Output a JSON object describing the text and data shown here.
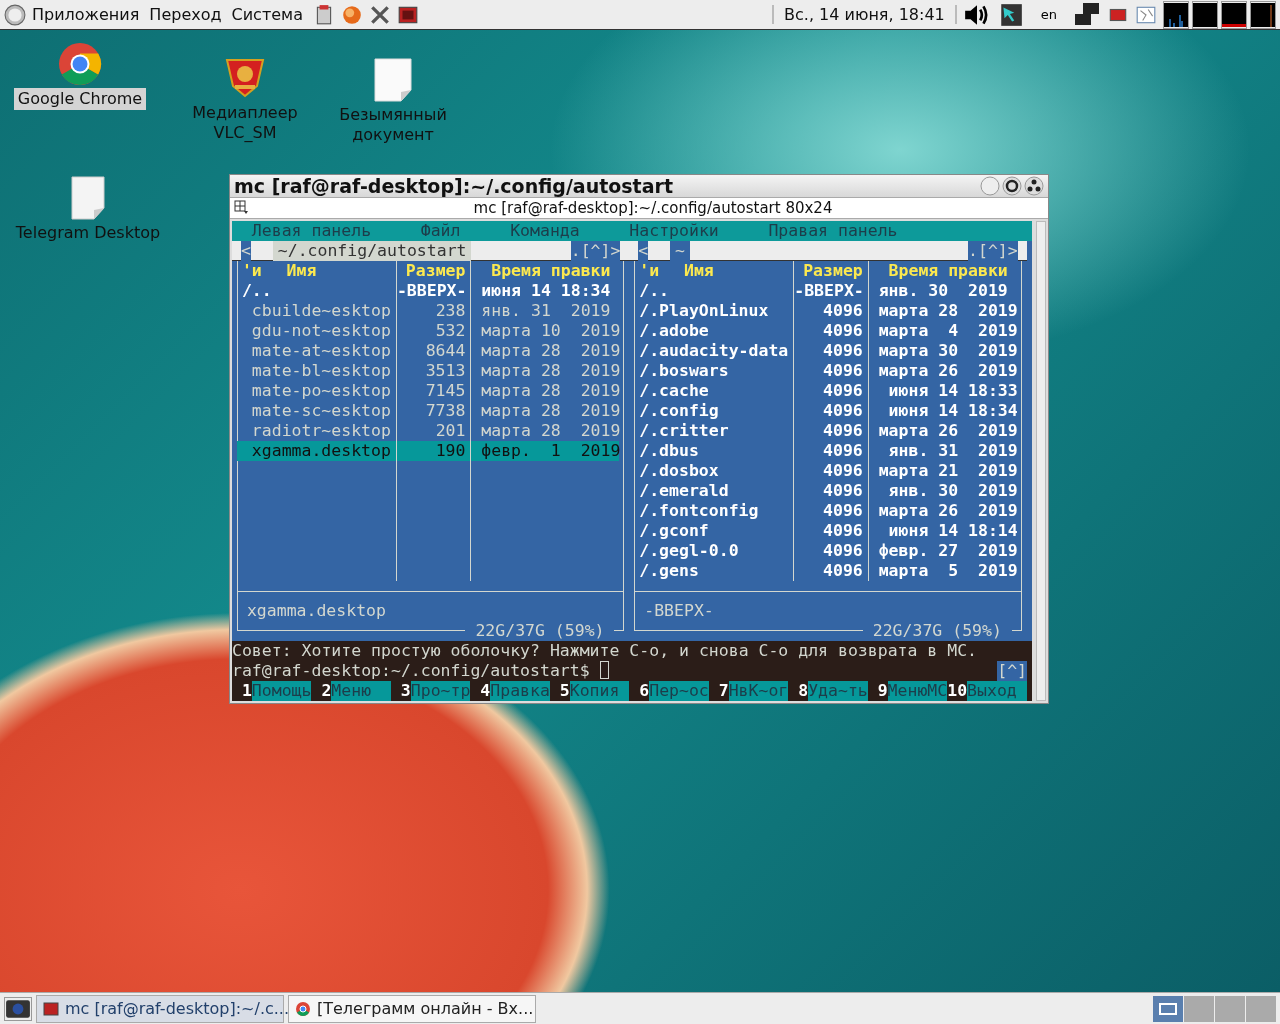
{
  "top_panel": {
    "menus": [
      "Приложения",
      "Переход",
      "Система"
    ],
    "clock": "Вс., 14 июня, 18:41",
    "layout": "en"
  },
  "desktop_icons": [
    {
      "label": "Google Chrome",
      "kind": "chrome",
      "selected": true
    },
    {
      "label": "Медиаплеер VLC_SM",
      "kind": "badge",
      "selected": false
    },
    {
      "label": "Безымянный документ",
      "kind": "document",
      "selected": false
    },
    {
      "label": "Telegram Desktop",
      "kind": "file",
      "selected": false
    }
  ],
  "terminal": {
    "title": "mc [raf@raf-desktop]:~/.config/autostart",
    "subtitle": "mc [raf@raf-desktop]:~/.config/autostart 80x24",
    "menu": [
      "Левая панель",
      "Файл",
      "Команда",
      "Настройки",
      "Правая панель"
    ],
    "panels": [
      {
        "path": "~/.config/autostart",
        "active": true,
        "nav_left": "<",
        "nav_right": ".[^]>",
        "sort_mark": "'и",
        "columns": [
          "Имя",
          "Размер",
          "Время правки"
        ],
        "rows": [
          {
            "name": "/..",
            "size": "-ВВЕРХ-",
            "date": "июня 14 18:34",
            "kind": "dir",
            "selected": false
          },
          {
            "name": "cbuilde~esktop",
            "size": "238",
            "date": "янв. 31  2019",
            "kind": "file",
            "selected": false
          },
          {
            "name": "gdu-not~esktop",
            "size": "532",
            "date": "марта 10  2019",
            "kind": "file",
            "selected": false
          },
          {
            "name": "mate-at~esktop",
            "size": "8644",
            "date": "марта 28  2019",
            "kind": "file",
            "selected": false
          },
          {
            "name": "mate-bl~esktop",
            "size": "3513",
            "date": "марта 28  2019",
            "kind": "file",
            "selected": false
          },
          {
            "name": "mate-po~esktop",
            "size": "7145",
            "date": "марта 28  2019",
            "kind": "file",
            "selected": false
          },
          {
            "name": "mate-sc~esktop",
            "size": "7738",
            "date": "марта 28  2019",
            "kind": "file",
            "selected": false
          },
          {
            "name": "radiotr~esktop",
            "size": "201",
            "date": "марта 28  2019",
            "kind": "file",
            "selected": false
          },
          {
            "name": "xgamma.desktop",
            "size": "190",
            "date": "февр.  1  2019",
            "kind": "file",
            "selected": true
          }
        ],
        "mini_status": "xgamma.desktop",
        "free": "22G/37G (59%)"
      },
      {
        "path": "~",
        "active": false,
        "nav_left": "<",
        "nav_right": ".[^]>",
        "sort_mark": "'и",
        "columns": [
          "Имя",
          "Размер",
          "Время правки"
        ],
        "rows": [
          {
            "name": "/..",
            "size": "-ВВЕРХ-",
            "date": "янв. 30  2019",
            "kind": "dir",
            "selected": false
          },
          {
            "name": "/.PlayOnLinux",
            "size": "4096",
            "date": "марта 28  2019",
            "kind": "dir",
            "selected": false
          },
          {
            "name": "/.adobe",
            "size": "4096",
            "date": "марта  4  2019",
            "kind": "dir",
            "selected": false
          },
          {
            "name": "/.audacity-data",
            "size": "4096",
            "date": "марта 30  2019",
            "kind": "dir",
            "selected": false
          },
          {
            "name": "/.boswars",
            "size": "4096",
            "date": "марта 26  2019",
            "kind": "dir",
            "selected": false
          },
          {
            "name": "/.cache",
            "size": "4096",
            "date": " июня 14 18:33",
            "kind": "dir",
            "selected": false
          },
          {
            "name": "/.config",
            "size": "4096",
            "date": " июня 14 18:34",
            "kind": "dir",
            "selected": false
          },
          {
            "name": "/.critter",
            "size": "4096",
            "date": "марта 26  2019",
            "kind": "dir",
            "selected": false
          },
          {
            "name": "/.dbus",
            "size": "4096",
            "date": " янв. 31  2019",
            "kind": "dir",
            "selected": false
          },
          {
            "name": "/.dosbox",
            "size": "4096",
            "date": "марта 21  2019",
            "kind": "dir",
            "selected": false
          },
          {
            "name": "/.emerald",
            "size": "4096",
            "date": " янв. 30  2019",
            "kind": "dir",
            "selected": false
          },
          {
            "name": "/.fontconfig",
            "size": "4096",
            "date": "марта 26  2019",
            "kind": "dir",
            "selected": false
          },
          {
            "name": "/.gconf",
            "size": "4096",
            "date": " июня 14 18:14",
            "kind": "dir",
            "selected": false
          },
          {
            "name": "/.gegl-0.0",
            "size": "4096",
            "date": "февр. 27  2019",
            "kind": "dir",
            "selected": false
          },
          {
            "name": "/.gens",
            "size": "4096",
            "date": "марта  5  2019",
            "kind": "dir",
            "selected": false
          }
        ],
        "mini_status": "-ВВЕРХ-",
        "free": "22G/37G (59%)"
      }
    ],
    "hint": "Совет: Хотите простую оболочку? Нажмите C-o, и снова C-o для возврата в MC.",
    "prompt": "raf@raf-desktop:~/.config/autostart$",
    "prompt_marker": "[^]",
    "fkeys": [
      {
        "num": "1",
        "label": "Помощь"
      },
      {
        "num": "2",
        "label": "Меню"
      },
      {
        "num": "3",
        "label": "Про~тр"
      },
      {
        "num": "4",
        "label": "Правка"
      },
      {
        "num": "5",
        "label": "Копия"
      },
      {
        "num": "6",
        "label": "Пер~ос"
      },
      {
        "num": "7",
        "label": "НвК~ог"
      },
      {
        "num": "8",
        "label": "Уда~ть"
      },
      {
        "num": "9",
        "label": "МенюМС"
      },
      {
        "num": "10",
        "label": "Выход"
      }
    ]
  },
  "taskbar": {
    "tasks": [
      {
        "label": "mc [raf@raf-desktop]:~/.c...",
        "kind": "terminal",
        "selected": true
      },
      {
        "label": "[Телеграмм онлайн - Вх...",
        "kind": "browser",
        "selected": false
      }
    ],
    "workspaces": [
      {
        "selected": true
      },
      {
        "selected": false
      },
      {
        "selected": false
      },
      {
        "selected": false
      }
    ]
  }
}
